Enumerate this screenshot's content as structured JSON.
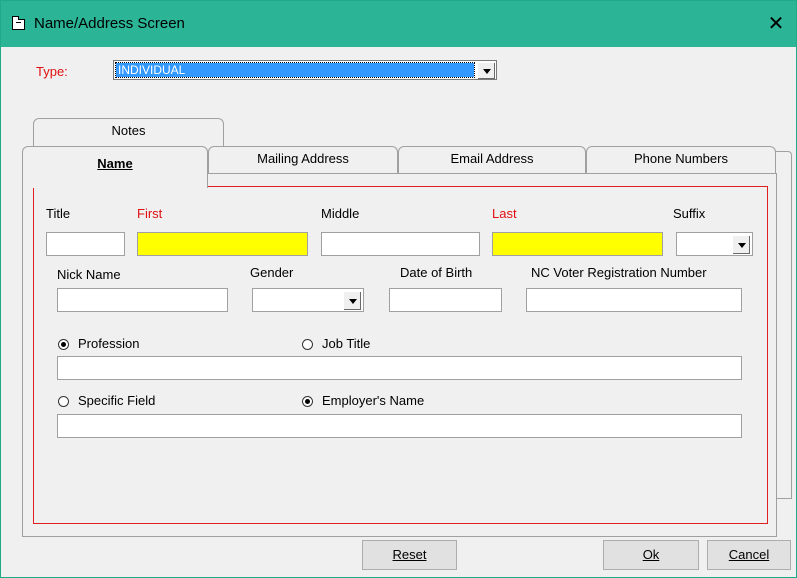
{
  "window": {
    "title": "Name/Address Screen",
    "close_glyph": "✕"
  },
  "type": {
    "label": "Type:",
    "value": "INDIVIDUAL"
  },
  "tabs": {
    "notes": "Notes",
    "name": "Name",
    "mailing_address": "Mailing Address",
    "email_address": "Email Address",
    "phone_numbers": "Phone Numbers"
  },
  "fields": {
    "title": {
      "label": "Title",
      "value": ""
    },
    "first": {
      "label": "First",
      "value": ""
    },
    "middle": {
      "label": "Middle",
      "value": ""
    },
    "last": {
      "label": "Last",
      "value": ""
    },
    "suffix": {
      "label": "Suffix",
      "value": ""
    },
    "nick_name": {
      "label": "Nick Name",
      "value": ""
    },
    "gender": {
      "label": "Gender",
      "value": ""
    },
    "date_of_birth": {
      "label": "Date of Birth",
      "value": ""
    },
    "voter_reg": {
      "label": "NC Voter Registration Number",
      "value": ""
    }
  },
  "radios": {
    "profession": {
      "label": "Profession",
      "checked": true
    },
    "job_title": {
      "label": "Job Title",
      "checked": false
    },
    "specific_field": {
      "label": "Specific Field",
      "checked": false
    },
    "employers_name": {
      "label": "Employer's Name",
      "checked": true
    }
  },
  "inputs": {
    "profession_value": "",
    "employer_value": ""
  },
  "buttons": {
    "reset": "Reset",
    "ok": "Ok",
    "cancel": "Cancel"
  },
  "colors": {
    "titlebar": "#2bb596",
    "required_label": "#e01010",
    "required_field": "#ffff00",
    "selection": "#3399ff"
  }
}
